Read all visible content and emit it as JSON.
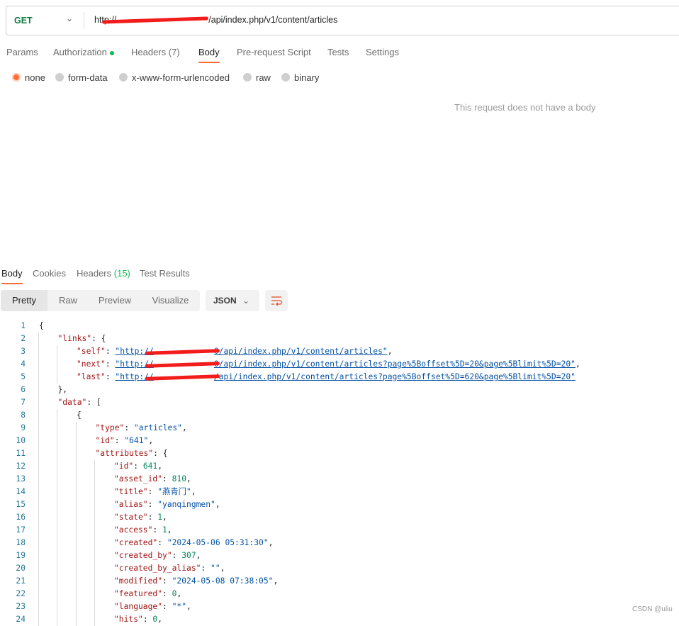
{
  "request": {
    "method": "GET",
    "url_prefix": "http://",
    "url_suffix": "/api/index.php/v1/content/articles"
  },
  "tabs": [
    {
      "label": "Params"
    },
    {
      "label": "Authorization"
    },
    {
      "label": "Headers",
      "count": "(7)"
    },
    {
      "label": "Body",
      "active": true
    },
    {
      "label": "Pre-request Script"
    },
    {
      "label": "Tests"
    },
    {
      "label": "Settings"
    }
  ],
  "body_types": [
    {
      "label": "none",
      "selected": true
    },
    {
      "label": "form-data"
    },
    {
      "label": "x-www-form-urlencoded"
    },
    {
      "label": "raw"
    },
    {
      "label": "binary"
    }
  ],
  "empty_body_message": "This request does not have a body",
  "response": {
    "tabs": [
      {
        "label": "Body",
        "active": true
      },
      {
        "label": "Cookies"
      },
      {
        "label": "Headers",
        "count": "(15)"
      },
      {
        "label": "Test Results"
      }
    ],
    "views": [
      "Pretty",
      "Raw",
      "Preview",
      "Visualize"
    ],
    "active_view": "Pretty",
    "format": "JSON",
    "lines": [
      {
        "i": 0,
        "t": [
          [
            "p",
            "{"
          ]
        ]
      },
      {
        "i": 1,
        "t": [
          [
            "k",
            "\"links\""
          ],
          [
            "p",
            ": {"
          ]
        ]
      },
      {
        "i": 2,
        "t": [
          [
            "k",
            "\"self\""
          ],
          [
            "p",
            ": "
          ],
          [
            "u",
            "\"http://"
          ],
          [
            "r",
            ""
          ],
          [
            "u",
            "0/api/index.php/v1/content/articles\""
          ],
          [
            "p",
            ","
          ]
        ]
      },
      {
        "i": 2,
        "t": [
          [
            "k",
            "\"next\""
          ],
          [
            "p",
            ": "
          ],
          [
            "u",
            "\"http://"
          ],
          [
            "r",
            ""
          ],
          [
            "u",
            "0/api/index.php/v1/content/articles?page%5Boffset%5D=20&page%5Blimit%5D=20\""
          ],
          [
            "p",
            ","
          ]
        ]
      },
      {
        "i": 2,
        "t": [
          [
            "k",
            "\"last\""
          ],
          [
            "p",
            ": "
          ],
          [
            "u",
            "\"http://"
          ],
          [
            "r",
            ""
          ],
          [
            "u",
            "/api/index.php/v1/content/articles?page%5Boffset%5D=620&page%5Blimit%5D=20\""
          ]
        ]
      },
      {
        "i": 1,
        "t": [
          [
            "p",
            "},"
          ]
        ]
      },
      {
        "i": 1,
        "t": [
          [
            "k",
            "\"data\""
          ],
          [
            "p",
            ": ["
          ]
        ]
      },
      {
        "i": 2,
        "t": [
          [
            "p",
            "{"
          ]
        ]
      },
      {
        "i": 3,
        "t": [
          [
            "k",
            "\"type\""
          ],
          [
            "p",
            ": "
          ],
          [
            "s",
            "\"articles\""
          ],
          [
            "p",
            ","
          ]
        ]
      },
      {
        "i": 3,
        "t": [
          [
            "k",
            "\"id\""
          ],
          [
            "p",
            ": "
          ],
          [
            "s",
            "\"641\""
          ],
          [
            "p",
            ","
          ]
        ]
      },
      {
        "i": 3,
        "t": [
          [
            "k",
            "\"attributes\""
          ],
          [
            "p",
            ": {"
          ]
        ]
      },
      {
        "i": 4,
        "t": [
          [
            "k",
            "\"id\""
          ],
          [
            "p",
            ": "
          ],
          [
            "n",
            "641"
          ],
          [
            "p",
            ","
          ]
        ]
      },
      {
        "i": 4,
        "t": [
          [
            "k",
            "\"asset_id\""
          ],
          [
            "p",
            ": "
          ],
          [
            "n",
            "810"
          ],
          [
            "p",
            ","
          ]
        ]
      },
      {
        "i": 4,
        "t": [
          [
            "k",
            "\"title\""
          ],
          [
            "p",
            ": "
          ],
          [
            "s",
            "\"燕青门\""
          ],
          [
            "p",
            ","
          ]
        ]
      },
      {
        "i": 4,
        "t": [
          [
            "k",
            "\"alias\""
          ],
          [
            "p",
            ": "
          ],
          [
            "s",
            "\"yanqingmen\""
          ],
          [
            "p",
            ","
          ]
        ]
      },
      {
        "i": 4,
        "t": [
          [
            "k",
            "\"state\""
          ],
          [
            "p",
            ": "
          ],
          [
            "n",
            "1"
          ],
          [
            "p",
            ","
          ]
        ]
      },
      {
        "i": 4,
        "t": [
          [
            "k",
            "\"access\""
          ],
          [
            "p",
            ": "
          ],
          [
            "n",
            "1"
          ],
          [
            "p",
            ","
          ]
        ]
      },
      {
        "i": 4,
        "t": [
          [
            "k",
            "\"created\""
          ],
          [
            "p",
            ": "
          ],
          [
            "s",
            "\"2024-05-06 05:31:30\""
          ],
          [
            "p",
            ","
          ]
        ]
      },
      {
        "i": 4,
        "t": [
          [
            "k",
            "\"created_by\""
          ],
          [
            "p",
            ": "
          ],
          [
            "n",
            "307"
          ],
          [
            "p",
            ","
          ]
        ]
      },
      {
        "i": 4,
        "t": [
          [
            "k",
            "\"created_by_alias\""
          ],
          [
            "p",
            ": "
          ],
          [
            "s",
            "\"\""
          ],
          [
            "p",
            ","
          ]
        ]
      },
      {
        "i": 4,
        "t": [
          [
            "k",
            "\"modified\""
          ],
          [
            "p",
            ": "
          ],
          [
            "s",
            "\"2024-05-08 07:38:05\""
          ],
          [
            "p",
            ","
          ]
        ]
      },
      {
        "i": 4,
        "t": [
          [
            "k",
            "\"featured\""
          ],
          [
            "p",
            ": "
          ],
          [
            "n",
            "0"
          ],
          [
            "p",
            ","
          ]
        ]
      },
      {
        "i": 4,
        "t": [
          [
            "k",
            "\"language\""
          ],
          [
            "p",
            ": "
          ],
          [
            "s",
            "\"*\""
          ],
          [
            "p",
            ","
          ]
        ]
      },
      {
        "i": 4,
        "t": [
          [
            "k",
            "\"hits\""
          ],
          [
            "p",
            ": "
          ],
          [
            "n",
            "0"
          ],
          [
            "p",
            ","
          ]
        ]
      }
    ]
  },
  "watermark": "CSDN @uliu",
  "colors": {
    "accent": "#ff6c37",
    "method": "#0b7a3e",
    "key": "#a31515",
    "string": "#0451a5",
    "number": "#098658"
  }
}
